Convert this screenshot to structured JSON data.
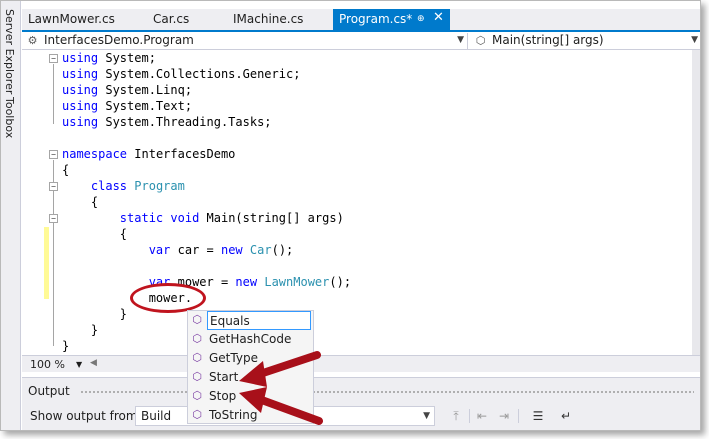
{
  "side_tabs": [
    "Server Explorer",
    "Toolbox"
  ],
  "tabs": [
    {
      "label": "LawnMower.cs"
    },
    {
      "label": "Car.cs"
    },
    {
      "label": "IMachine.cs"
    },
    {
      "label": "Program.cs*",
      "active": true
    }
  ],
  "tab_icons": {
    "pin": "pin-icon",
    "close": "close-icon"
  },
  "navbar": {
    "left": "InterfacesDemo.Program",
    "right": "Main(string[] args)"
  },
  "code": {
    "using_kw": "using",
    "usings": [
      "System;",
      "System.Collections.Generic;",
      "System.Linq;",
      "System.Text;",
      "System.Threading.Tasks;"
    ],
    "namespace_kw": "namespace",
    "namespace_name": "InterfacesDemo",
    "open_brace": "{",
    "close_brace": "}",
    "class_kw": "class",
    "class_name": "Program",
    "static_kw": "static",
    "void_kw": "void",
    "method_sig": "Main(string[] args)",
    "var_kw": "var",
    "car_assign": "car = ",
    "new_kw": "new",
    "car_type": "Car",
    "car_tail": "();",
    "mower_assign": "mower = ",
    "mower_type": "LawnMower",
    "mower_tail": "();",
    "typing": "mower."
  },
  "intellisense": {
    "items": [
      "Equals",
      "GetHashCode",
      "GetType",
      "Start",
      "Stop",
      "ToString"
    ],
    "selected": "Equals",
    "icon": "method-cube-icon"
  },
  "zoom": "100 %",
  "output": {
    "title": "Output",
    "show_from_label": "Show output from:",
    "source": "Build"
  },
  "colors": {
    "accent": "#007acc",
    "keyword": "#0000ff",
    "type": "#2b91af",
    "annotation": "#c0141e"
  }
}
